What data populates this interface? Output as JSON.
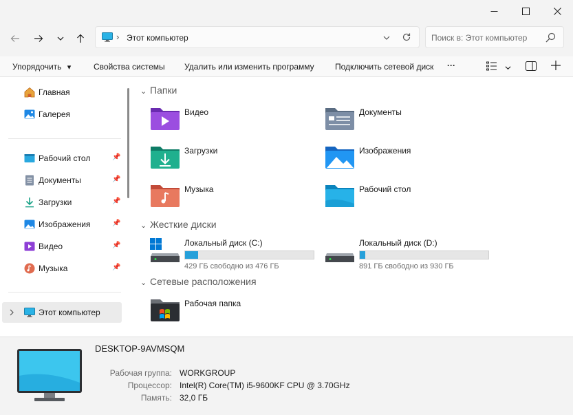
{
  "window": {
    "minimize_icon": "minimize-icon",
    "maximize_icon": "maximize-icon",
    "close_icon": "close-icon"
  },
  "address": {
    "path": "Этот компьютер",
    "separator": "›",
    "search_placeholder": "Поиск в: Этот компьютер"
  },
  "commands": {
    "organize": "Упорядочить",
    "organize_arrow": "⌄",
    "system_properties": "Свойства системы",
    "uninstall": "Удалить или изменить программу",
    "map_drive": "Подключить сетевой диск",
    "more": "···"
  },
  "sidebar": {
    "top": [
      {
        "label": "Главная",
        "icon": "home-icon"
      },
      {
        "label": "Галерея",
        "icon": "gallery-icon"
      }
    ],
    "pinned": [
      {
        "label": "Рабочий стол",
        "icon": "desktop-icon"
      },
      {
        "label": "Документы",
        "icon": "documents-icon"
      },
      {
        "label": "Загрузки",
        "icon": "downloads-icon"
      },
      {
        "label": "Изображения",
        "icon": "pictures-icon"
      },
      {
        "label": "Видео",
        "icon": "videos-icon"
      },
      {
        "label": "Музыка",
        "icon": "music-icon"
      }
    ],
    "this_pc": {
      "label": "Этот компьютер",
      "icon": "monitor-icon"
    }
  },
  "sections": {
    "folders": "Папки",
    "drives": "Жесткие диски",
    "network": "Сетевые расположения"
  },
  "folders": [
    {
      "label": "Видео",
      "color": "#8e3fd6"
    },
    {
      "label": "Документы",
      "color": "#6b7c94"
    },
    {
      "label": "Загрузки",
      "color": "#16a085"
    },
    {
      "label": "Изображения",
      "color": "#1e88e5"
    },
    {
      "label": "Музыка",
      "color": "#e06b4f"
    },
    {
      "label": "Рабочий стол",
      "color": "#1aa3d9"
    }
  ],
  "drives": [
    {
      "name": "Локальный диск (C:)",
      "free_text": "429 ГБ свободно из 476 ГБ",
      "used_fraction": 0.099
    },
    {
      "name": "Локальный диск (D:)",
      "free_text": "891 ГБ свободно из 930 ГБ",
      "used_fraction": 0.042
    }
  ],
  "network": [
    {
      "label": "Рабочая папка"
    }
  ],
  "details": {
    "computer_name": "DESKTOP-9AVMSQM",
    "workgroup_label": "Рабочая группа:",
    "workgroup": "WORKGROUP",
    "cpu_label": "Процессор:",
    "cpu": "Intel(R) Core(TM) i5-9600KF CPU @ 3.70GHz",
    "ram_label": "Память:",
    "ram": "32,0 ГБ"
  },
  "colors": {
    "accent": "#26a0da"
  }
}
